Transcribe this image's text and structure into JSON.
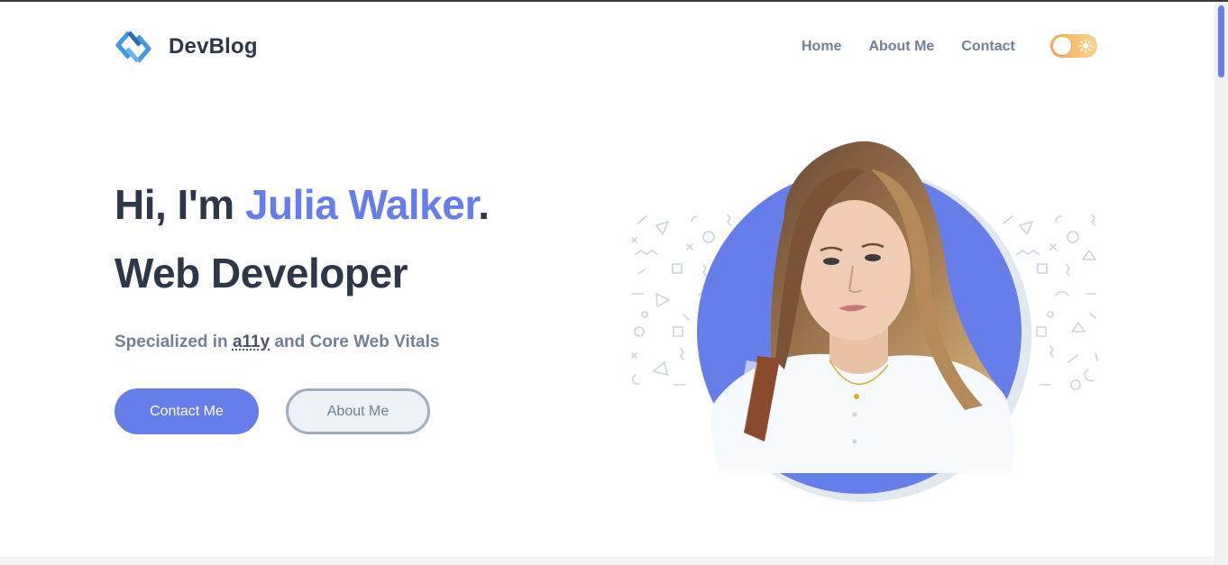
{
  "header": {
    "logo_text": "DevBlog",
    "nav": [
      {
        "label": "Home"
      },
      {
        "label": "About Me"
      },
      {
        "label": "Contact"
      }
    ]
  },
  "theme_toggle": {
    "state": "light",
    "icon": "sun-icon"
  },
  "hero": {
    "greeting": "Hi, I'm ",
    "name": "Julia Walker",
    "punct": ".",
    "role": "Web Developer",
    "subtitle_prefix": "Specialized in ",
    "subtitle_abbr": "a11y",
    "subtitle_suffix": " and Core Web Vitals",
    "primary_button": "Contact Me",
    "secondary_button": "About Me"
  },
  "colors": {
    "accent": "#667eea",
    "heading": "#2d3748",
    "muted": "#718096",
    "toggle_gradient_start": "#f6ad55",
    "toggle_gradient_end": "#fbd38d"
  },
  "icons": {
    "logo": "devblog-logo-icon",
    "toggle": "sun-icon"
  }
}
